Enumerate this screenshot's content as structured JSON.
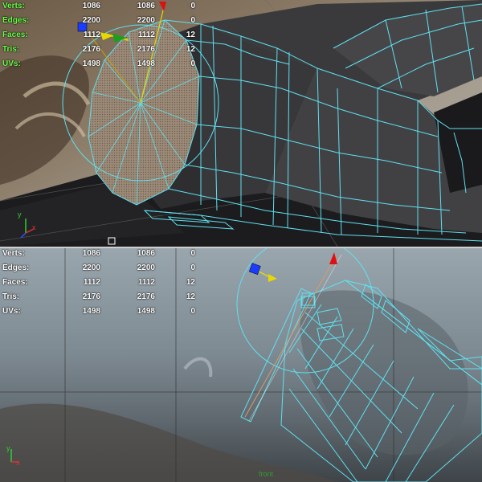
{
  "top_view": {
    "stats": [
      {
        "label": "Verts:",
        "v1": "1086",
        "v2": "1086",
        "v3": "0"
      },
      {
        "label": "Edges:",
        "v1": "2200",
        "v2": "2200",
        "v3": "0"
      },
      {
        "label": "Faces:",
        "v1": "1112",
        "v2": "1112",
        "v3": "12"
      },
      {
        "label": "Tris:",
        "v1": "2176",
        "v2": "2176",
        "v3": "12"
      },
      {
        "label": "UVs:",
        "v1": "1498",
        "v2": "1498",
        "v3": "0"
      }
    ],
    "axis_labels": {
      "y": "y",
      "x": "x"
    }
  },
  "bottom_view": {
    "stats": [
      {
        "label": "Verts:",
        "v1": "1086",
        "v2": "1086",
        "v3": "0"
      },
      {
        "label": "Edges:",
        "v1": "2200",
        "v2": "2200",
        "v3": "0"
      },
      {
        "label": "Faces:",
        "v1": "1112",
        "v2": "1112",
        "v3": "12"
      },
      {
        "label": "Tris:",
        "v1": "2176",
        "v2": "2176",
        "v3": "12"
      },
      {
        "label": "UVs:",
        "v1": "1498",
        "v2": "1498",
        "v3": "0"
      }
    ],
    "camera_name": "front",
    "axis_labels": {
      "y": "y",
      "x": "x"
    }
  },
  "colors": {
    "wireframe": "#5fe0f0",
    "mesh_face": "#3c3c3e",
    "selected_face": "#9c8a78",
    "manip_blue": "#1a3cff",
    "manip_yellow": "#e8d800",
    "manip_red": "#e01010",
    "manip_green": "#1aa01a",
    "hud_label_green": "#6cff4a",
    "divider": "#cfcfcf"
  }
}
